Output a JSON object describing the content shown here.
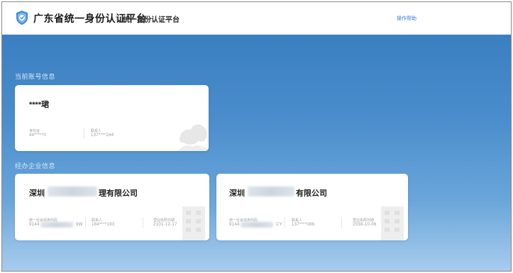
{
  "header": {
    "platform_title": "广东省统一身份认证平台",
    "subtitle": "统一身份认证平台",
    "help_link": "操作帮助"
  },
  "colors": {
    "header_bg": "#ffffff",
    "main_gradient_top": "#3a7fc1",
    "main_gradient_bottom": "#a9cdee",
    "logo_blue": "#3d8be0",
    "card_bg": "#ffffff"
  },
  "account_section": {
    "title": "当前账号信息",
    "card": {
      "name": "****珺",
      "id_label": "身份证",
      "id_value": "44*****0",
      "phone_label": "联系人",
      "phone_value": "137****244",
      "decoration_icon": "cloud-icon"
    }
  },
  "enterprise_section": {
    "title": "经办企业信息",
    "cards": [
      {
        "name_prefix": "深圳",
        "name_suffix": "理有限公司",
        "code_label": "统一社会信用代码",
        "code_prefix": "9144",
        "code_suffix": "9W",
        "phone_label": "联系人",
        "phone_value": "184****193",
        "expiry_label": "营业执照日期",
        "expiry_value": "2101-12-17",
        "decoration_icon": "building-icon"
      },
      {
        "name_prefix": "深圳",
        "name_suffix": "有限公司",
        "code_label": "统一社会信用代码",
        "code_prefix": "9144",
        "code_suffix": "CY",
        "phone_label": "联系人",
        "phone_value": "137****086",
        "expiry_label": "营业执照日期",
        "expiry_value": "2038-10-06",
        "decoration_icon": "building-icon"
      }
    ]
  }
}
